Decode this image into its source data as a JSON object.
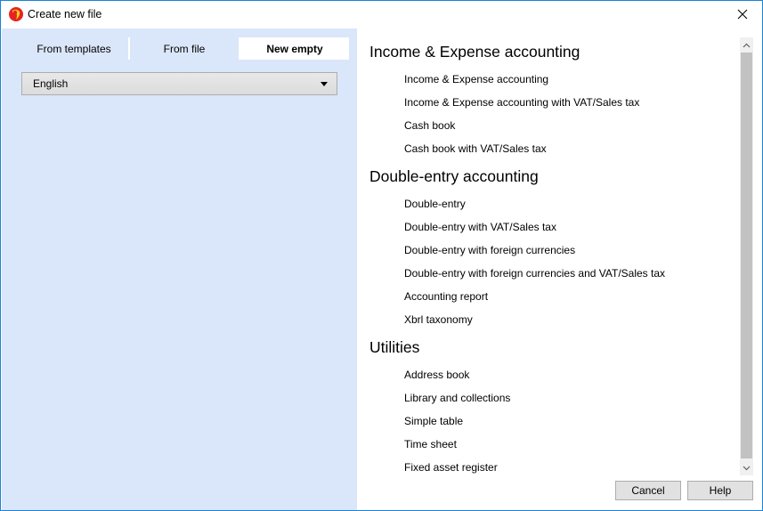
{
  "window": {
    "title": "Create new file",
    "icon": "banana-logo-icon"
  },
  "tabs": [
    {
      "label": "From templates",
      "active": false
    },
    {
      "label": "From file",
      "active": false
    },
    {
      "label": "New empty",
      "active": true
    }
  ],
  "language_select": {
    "value": "English"
  },
  "sections": [
    {
      "title": "Income & Expense accounting",
      "items": [
        "Income & Expense accounting",
        "Income & Expense accounting with VAT/Sales tax",
        "Cash book",
        "Cash book with VAT/Sales tax"
      ]
    },
    {
      "title": "Double-entry accounting",
      "items": [
        "Double-entry",
        "Double-entry with VAT/Sales tax",
        "Double-entry with foreign currencies",
        "Double-entry with foreign currencies and VAT/Sales tax",
        "Accounting report",
        "Xbrl taxonomy"
      ]
    },
    {
      "title": "Utilities",
      "items": [
        "Address book",
        "Library and collections",
        "Simple table",
        "Time sheet",
        "Fixed asset register"
      ]
    }
  ],
  "buttons": {
    "cancel": "Cancel",
    "help": "Help"
  },
  "colors": {
    "left_panel_bg": "#dae6fa",
    "window_border": "#1883d7"
  }
}
